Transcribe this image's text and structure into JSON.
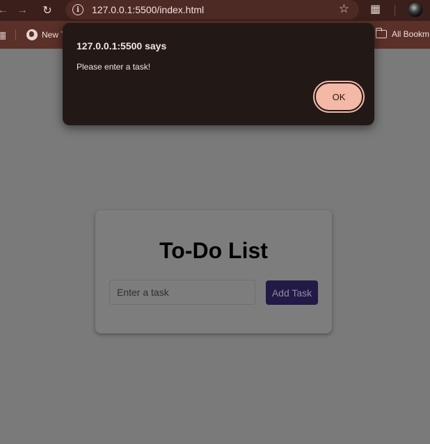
{
  "browser": {
    "url": "127.0.0.1:5500/index.html",
    "bookmarks": [
      {
        "label": "New T",
        "icon": "globe-icon"
      }
    ],
    "all_bookmarks_label": "All Bookm"
  },
  "alert": {
    "title": "127.0.0.1:5500 says",
    "message": "Please enter a task!",
    "ok_label": "OK"
  },
  "todo": {
    "title": "To-Do List",
    "input_placeholder": "Enter a task",
    "input_value": "",
    "add_button_label": "Add Task"
  },
  "colors": {
    "accent_button": "#231a47",
    "ok_button": "#f4b8a6",
    "chrome": "#3a1f1b"
  }
}
